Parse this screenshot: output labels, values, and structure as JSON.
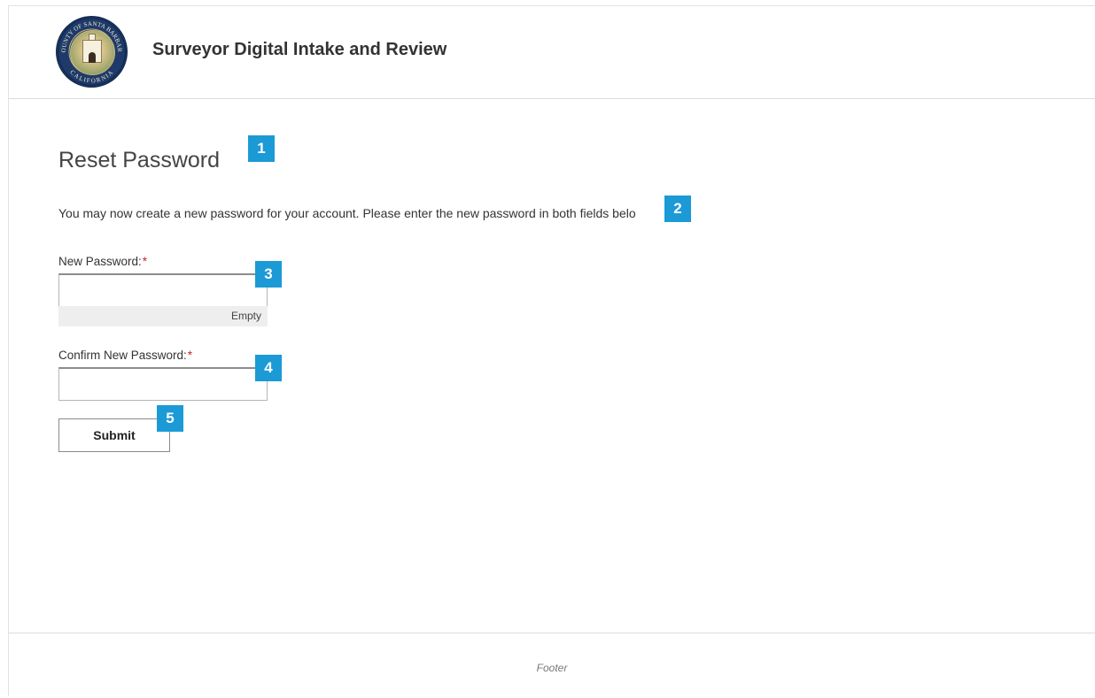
{
  "header": {
    "site_title": "Surveyor Digital Intake and Review",
    "logo_ring_top": "COUNTY OF SANTA BARBARA",
    "logo_ring_bottom": "CALIFORNIA"
  },
  "main": {
    "page_title": "Reset Password",
    "intro_text": "You may now create a new password for your account. Please enter the new password in both fields belo",
    "new_password": {
      "label": "New Password:",
      "required_marker": "*",
      "value": "",
      "strength_text": "Empty"
    },
    "confirm_password": {
      "label": "Confirm New Password:",
      "required_marker": "*",
      "value": ""
    },
    "submit_label": "Submit"
  },
  "annotations": {
    "badge_1": "1",
    "badge_2": "2",
    "badge_3": "3",
    "badge_4": "4",
    "badge_5": "5"
  },
  "footer": {
    "text": "Footer"
  },
  "colors": {
    "badge": "#1b9ad6",
    "required": "#c0272d",
    "logo_ring": "#1e3a6a"
  }
}
